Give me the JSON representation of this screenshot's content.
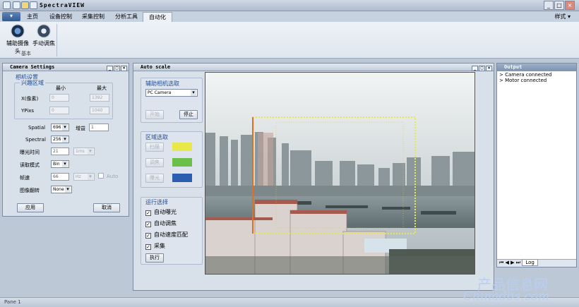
{
  "app": {
    "title": "SpectraVIEW"
  },
  "ribbon": {
    "tabs": [
      "主页",
      "设备控制",
      "采集控制",
      "分析工具",
      "自动化"
    ],
    "active_tab": "自动化",
    "style_menu": "样式",
    "buttons": [
      {
        "label": "辅助摄像头",
        "icon": "webcam-icon"
      },
      {
        "label": "手动调焦",
        "icon": "focus-icon"
      }
    ],
    "group_label": "基本"
  },
  "camera_settings": {
    "title": "Camera Settings",
    "section": "相机设置",
    "roi_label": "兴趣区域",
    "col_min": "最小",
    "col_max": "最大",
    "x_label": "X(像素)",
    "y_label": "YPixs",
    "x_min": "0",
    "x_max": "1392",
    "y_min": "0",
    "y_max": "1040",
    "spatial_label": "Spatial",
    "spatial_value": "696",
    "gain_label": "增益",
    "gain_value": "1",
    "spectral_label": "Spectral",
    "spectral_value": "256",
    "exposure_label": "曝光时间",
    "exposure_value": "21",
    "exposure_unit": "1ms",
    "readmode_label": "读取模式",
    "readmode_value": "Bin",
    "framerate_label": "帧速",
    "framerate_value": "66",
    "framerate_unit": "Hz",
    "auto_label": "Auto",
    "flip_label": "图像翻转",
    "flip_value": "None",
    "apply_label": "应用",
    "cancel_label": "取消"
  },
  "auto_scale": {
    "title": "Auto scale",
    "cam_section": "辅助相机选取",
    "camera_value": "PC Camera",
    "start_label": "开始",
    "stop_label": "停止",
    "region_section": "区域选取",
    "region_buttons": [
      "扫描",
      "调焦",
      "曝光"
    ],
    "region_colors": [
      "#e8e84a",
      "#6cc04a",
      "#2a5fb0"
    ],
    "run_section": "运行选择",
    "run_options": [
      {
        "label": "自动曝光",
        "checked": true
      },
      {
        "label": "自动调焦",
        "checked": true
      },
      {
        "label": "自动速度匹配",
        "checked": true
      },
      {
        "label": "采集",
        "checked": true
      }
    ],
    "execute_label": "执行"
  },
  "output": {
    "title": "Output",
    "lines": [
      "Camera connected",
      "Motor connected"
    ],
    "tab_label": "Log"
  },
  "status": {
    "pane": "Pane 1"
  },
  "watermark": {
    "line1": "产品信息网",
    "line2": "Chinadbs.com"
  }
}
